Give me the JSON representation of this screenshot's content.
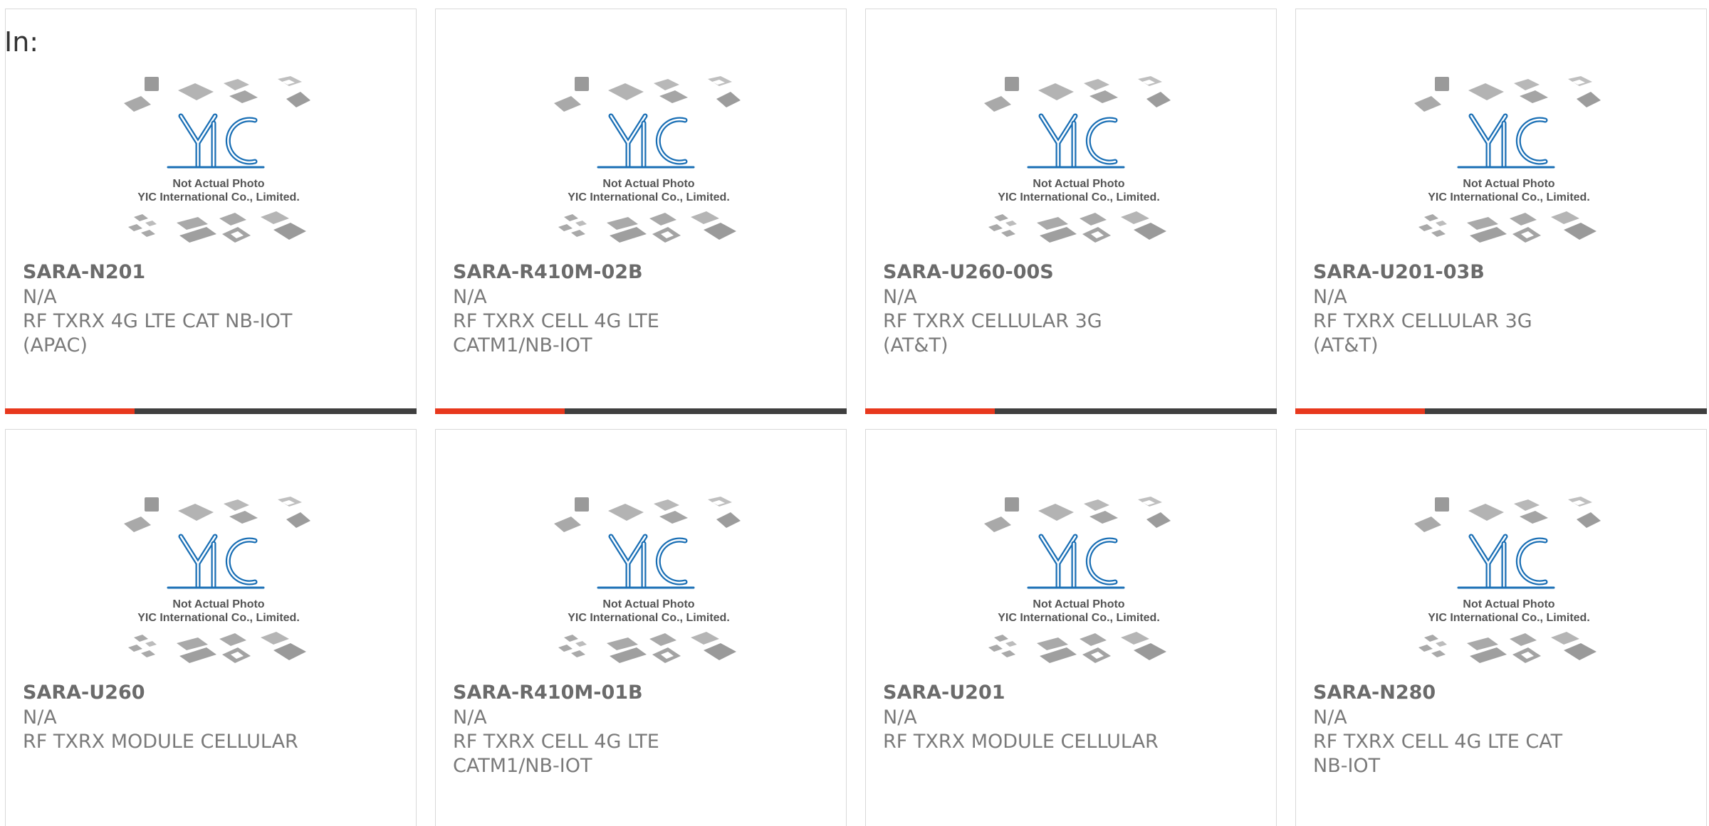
{
  "page": {
    "label": "In:"
  },
  "colors": {
    "accent_bar": "#e8381d",
    "dark_bar": "#3f3f3f",
    "logo_blue": "#1a6fb5",
    "card_border": "#d9d9d9"
  },
  "placeholder": {
    "caption_line1": "Not Actual Photo",
    "caption_line2": "YIC International Co., Limited.",
    "logo_text": "YIC",
    "icon": "chip-packages-icon"
  },
  "products": [
    {
      "part": "SARA-N201",
      "manufacturer": "N/A",
      "description": "RF TXRX 4G LTE CAT NB-IOT (APAC)"
    },
    {
      "part": "SARA-R410M-02B",
      "manufacturer": "N/A",
      "description": "RF TXRX CELL 4G LTE CATM1/NB-IOT"
    },
    {
      "part": "SARA-U260-00S",
      "manufacturer": "N/A",
      "description": "RF TXRX CELLULAR 3G (AT&T)"
    },
    {
      "part": "SARA-U201-03B",
      "manufacturer": "N/A",
      "description": "RF TXRX CELLULAR 3G (AT&T)"
    },
    {
      "part": "SARA-U260",
      "manufacturer": "N/A",
      "description": "RF TXRX MODULE CELLULAR"
    },
    {
      "part": "SARA-R410M-01B",
      "manufacturer": "N/A",
      "description": "RF TXRX CELL 4G LTE CATM1/NB-IOT"
    },
    {
      "part": "SARA-U201",
      "manufacturer": "N/A",
      "description": "RF TXRX MODULE CELLULAR"
    },
    {
      "part": "SARA-N280",
      "manufacturer": "N/A",
      "description": "RF TXRX CELL 4G LTE CAT NB-IOT"
    }
  ]
}
